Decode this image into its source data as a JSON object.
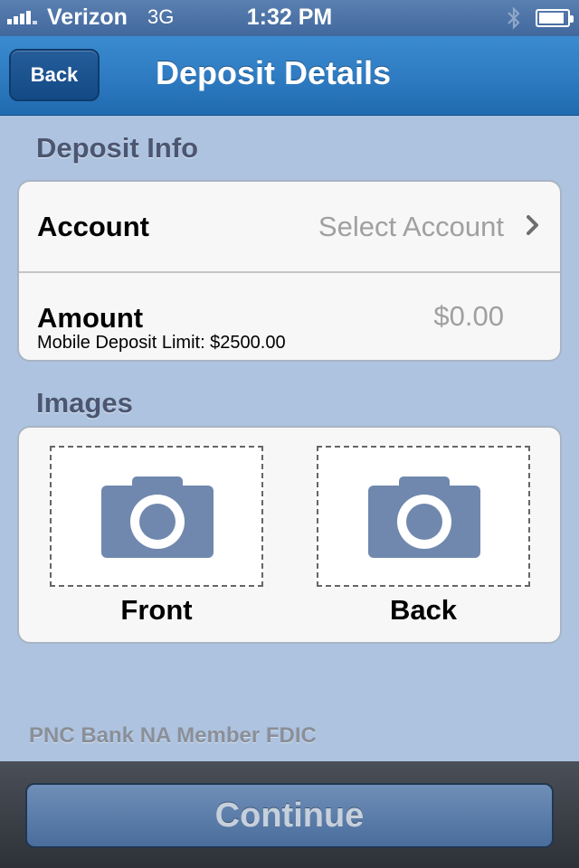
{
  "status_bar": {
    "carrier": "Verizon",
    "network": "3G",
    "time": "1:32 PM",
    "signal_bars": 4,
    "battery_level": 0.8
  },
  "nav": {
    "back_label": "Back",
    "title": "Deposit Details"
  },
  "deposit_info": {
    "header": "Deposit Info",
    "account_label": "Account",
    "account_value": "Select Account",
    "amount_label": "Amount",
    "amount_value": "$0.00",
    "limit_text": "Mobile Deposit Limit: $2500.00"
  },
  "images": {
    "header": "Images",
    "front_label": "Front",
    "back_label": "Back",
    "icon": "camera-icon"
  },
  "footer": {
    "text": "PNC Bank NA Member FDIC"
  },
  "toolbar": {
    "continue_label": "Continue"
  },
  "colors": {
    "background": "#adc3e0",
    "nav_bar": "#2f7cc3",
    "camera_icon": "#7088ae",
    "continue_button": "#5a7dab"
  }
}
